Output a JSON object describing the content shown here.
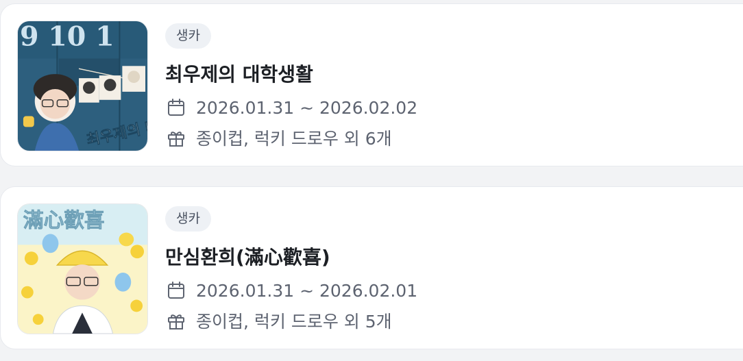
{
  "colors": {
    "card_bg": "#ffffff",
    "page_bg": "#f2f3f5",
    "badge_bg": "#eef1f5",
    "title_text": "#1c1f24",
    "meta_text": "#5d6370"
  },
  "events": [
    {
      "category": "생카",
      "title": "최우제의 대학생활",
      "date_range": "2026.01.31 ~ 2026.02.02",
      "gifts": "종이컵, 럭키 드로우 외 6개",
      "thumbnail": {
        "description_icon": "event-poster-image",
        "poster_text_top": "9 10 1",
        "poster_text": "최우제의 대학생활"
      }
    },
    {
      "category": "생카",
      "title": "만심환희(滿心歡喜)",
      "date_range": "2026.01.31 ~ 2026.02.01",
      "gifts": "종이컵, 럭키 드로우 외 5개",
      "thumbnail": {
        "description_icon": "event-poster-image",
        "poster_text": "滿心歡喜"
      }
    }
  ],
  "icons": {
    "date": "calendar-icon",
    "gift": "gift-icon"
  }
}
